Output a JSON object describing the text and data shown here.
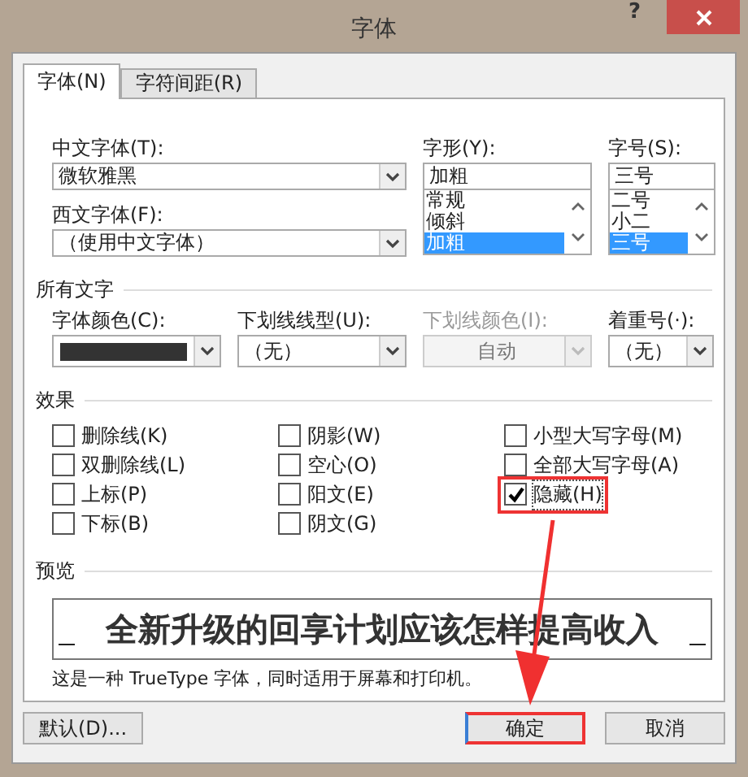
{
  "window": {
    "title": "字体",
    "help": "?"
  },
  "tabs": [
    {
      "label": "字体(N)",
      "selected": true
    },
    {
      "label": "字符间距(R)",
      "selected": false
    }
  ],
  "fonts": {
    "chinese_font": {
      "label": "中文字体(T):",
      "value": "微软雅黑"
    },
    "western_font": {
      "label": "西文字体(F):",
      "value": "（使用中文字体）"
    },
    "style": {
      "label": "字形(Y):",
      "value": "加粗",
      "options": [
        {
          "label": "常规",
          "selected": false
        },
        {
          "label": "倾斜",
          "selected": false
        },
        {
          "label": "加粗",
          "selected": true
        }
      ]
    },
    "size": {
      "label": "字号(S):",
      "value": "三号",
      "options": [
        {
          "label": "二号",
          "selected": false
        },
        {
          "label": "小二",
          "selected": false
        },
        {
          "label": "三号",
          "selected": true
        }
      ]
    }
  },
  "all_text": {
    "title": "所有文字",
    "controls": [
      {
        "kind": "color",
        "label": "字体颜色(C):",
        "color": "#333333"
      },
      {
        "kind": "combo",
        "label": "下划线线型(U):",
        "value": "（无）",
        "disabled": false
      },
      {
        "kind": "combo",
        "label": "下划线颜色(I):",
        "value": "自动",
        "disabled": true
      },
      {
        "kind": "combo",
        "label": "着重号(·):",
        "value": "（无）",
        "disabled": false
      }
    ]
  },
  "effects": {
    "title": "效果",
    "items": [
      {
        "label": "删除线(K)",
        "checked": false,
        "highlighted": false
      },
      {
        "label": "双删除线(L)",
        "checked": false,
        "highlighted": false
      },
      {
        "label": "上标(P)",
        "checked": false,
        "highlighted": false
      },
      {
        "label": "下标(B)",
        "checked": false,
        "highlighted": false
      },
      {
        "label": "阴影(W)",
        "checked": false,
        "highlighted": false
      },
      {
        "label": "空心(O)",
        "checked": false,
        "highlighted": false
      },
      {
        "label": "阳文(E)",
        "checked": false,
        "highlighted": false
      },
      {
        "label": "阴文(G)",
        "checked": false,
        "highlighted": false
      },
      {
        "label": "小型大写字母(M)",
        "checked": false,
        "highlighted": false
      },
      {
        "label": "全部大写字母(A)",
        "checked": false,
        "highlighted": false
      },
      {
        "label": "隐藏(H)",
        "checked": true,
        "highlighted": true
      }
    ]
  },
  "preview": {
    "title": "预览",
    "sample": "全新升级的回享计划应该怎样提高收入",
    "note": "这是一种 TrueType 字体，同时适用于屏幕和打印机。"
  },
  "buttons": [
    {
      "label": "默认(D)...",
      "kind": "left",
      "highlighted": false
    },
    {
      "label": "确定",
      "kind": "right",
      "highlighted": true
    },
    {
      "label": "取消",
      "kind": "right",
      "highlighted": false
    }
  ]
}
